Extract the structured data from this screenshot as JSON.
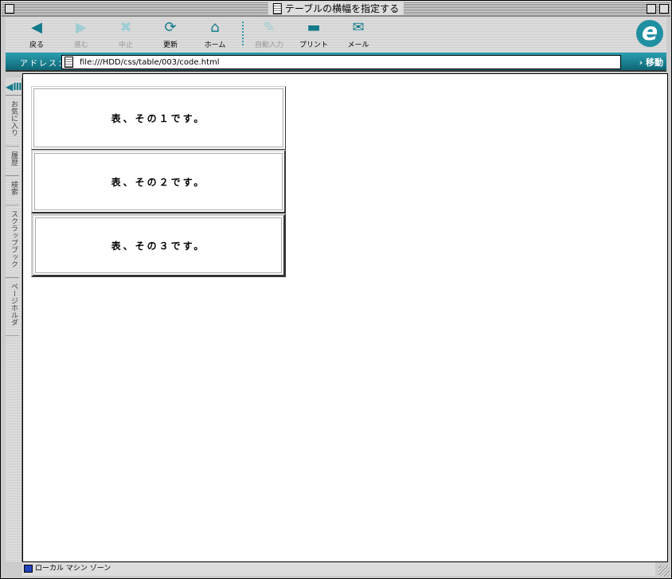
{
  "window": {
    "title": "テーブルの横幅を指定する"
  },
  "toolbar": {
    "buttons": [
      {
        "label": "戻る",
        "icon": "back-icon",
        "enabled": true
      },
      {
        "label": "進む",
        "icon": "forward-icon",
        "enabled": false
      },
      {
        "label": "中止",
        "icon": "stop-icon",
        "enabled": false
      },
      {
        "label": "更新",
        "icon": "refresh-icon",
        "enabled": true
      },
      {
        "label": "ホーム",
        "icon": "home-icon",
        "enabled": true
      },
      {
        "label": "自動入力",
        "icon": "autofill-icon",
        "enabled": false
      },
      {
        "label": "プリント",
        "icon": "print-icon",
        "enabled": true
      },
      {
        "label": "メール",
        "icon": "mail-icon",
        "enabled": true
      }
    ]
  },
  "address": {
    "label": "アドレス：",
    "value": "file:///HDD/css/table/003/code.html",
    "go": "移動"
  },
  "sidebar": {
    "tabs": [
      "お気に入り",
      "履歴",
      "検索",
      "スクラップブック",
      "ページホルダ"
    ]
  },
  "content": {
    "tables": [
      "表、その１です。",
      "表、その２です。",
      "表、その３です。"
    ]
  },
  "status": {
    "zone": "ローカル マシン ゾーン"
  },
  "colors": {
    "accent": "#1f8fa1"
  }
}
